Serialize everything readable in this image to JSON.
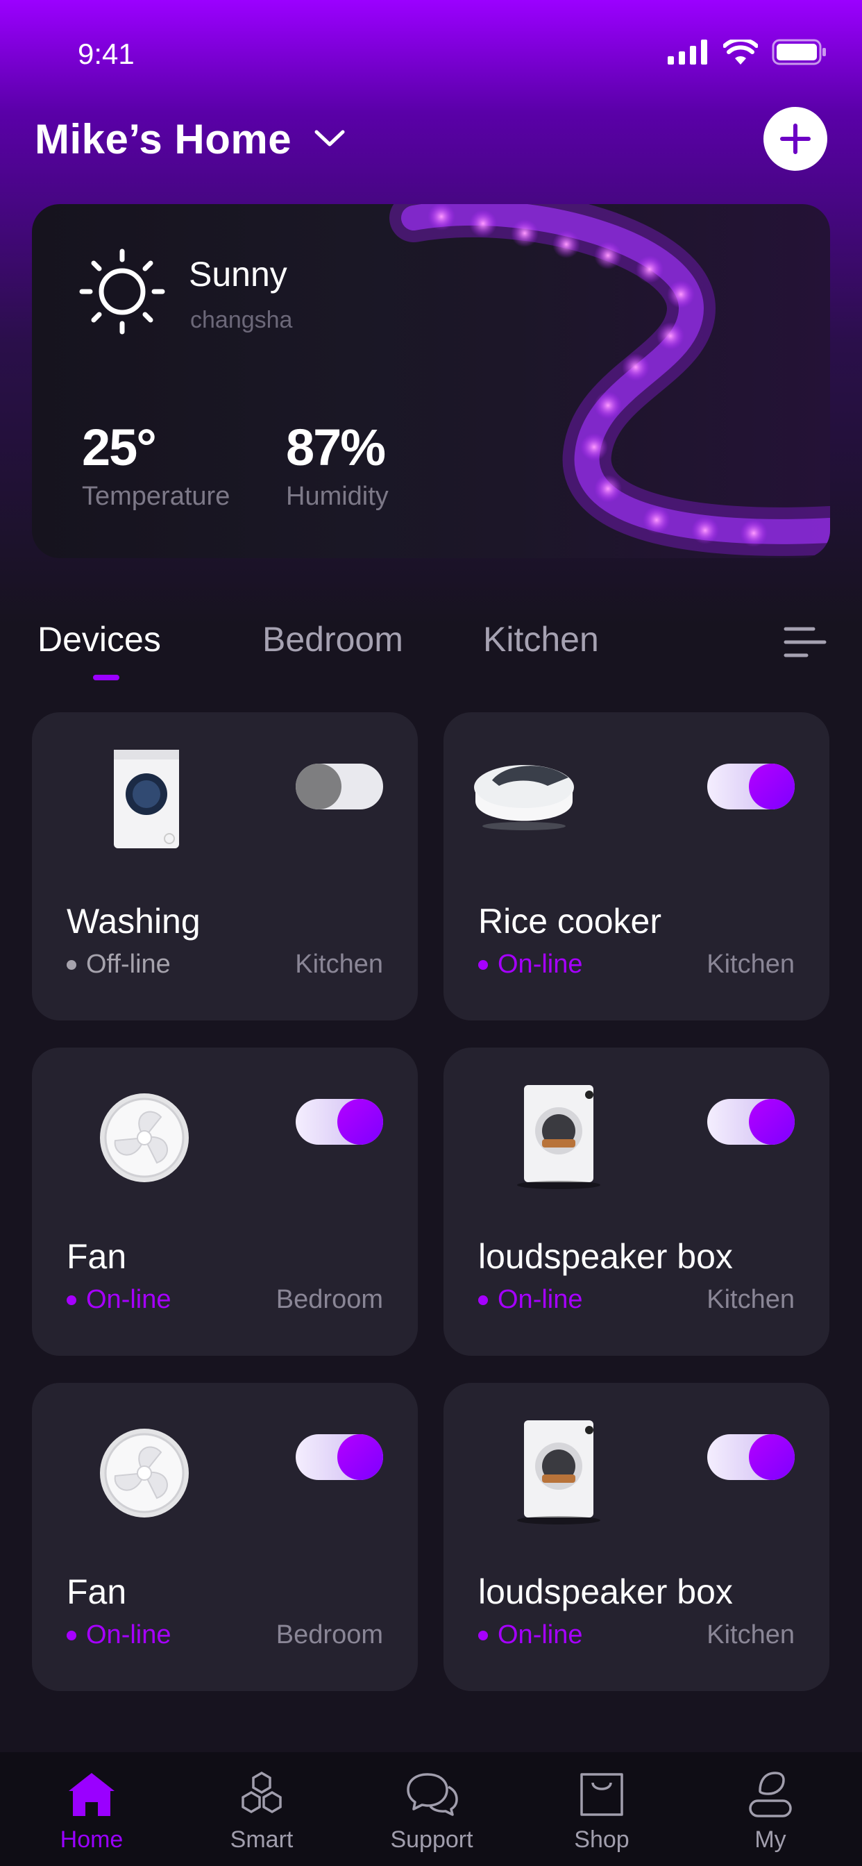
{
  "status_bar": {
    "time": "9:41"
  },
  "header": {
    "home_name": "Mike’s Home"
  },
  "weather": {
    "condition": "Sunny",
    "city": "changsha",
    "temperature_value": "25°",
    "temperature_label": "Temperature",
    "humidity_value": "87%",
    "humidity_label": "Humidity"
  },
  "tabs": [
    {
      "label": "Devices",
      "active": true
    },
    {
      "label": "Bedroom",
      "active": false
    },
    {
      "label": "Kitchen",
      "active": false
    }
  ],
  "devices": [
    {
      "name": "Washing",
      "status": "Off-line",
      "room": "Kitchen",
      "power_on": false,
      "icon": "washing-machine-icon"
    },
    {
      "name": "Rice cooker",
      "status": "On-line",
      "room": "Kitchen",
      "power_on": true,
      "icon": "rice-cooker-icon"
    },
    {
      "name": "Fan",
      "status": "On-line",
      "room": "Bedroom",
      "power_on": true,
      "icon": "fan-icon"
    },
    {
      "name": "loudspeaker box",
      "status": "On-line",
      "room": "Kitchen",
      "power_on": true,
      "icon": "loudspeaker-icon"
    },
    {
      "name": "Fan",
      "status": "On-line",
      "room": "Bedroom",
      "power_on": true,
      "icon": "fan-icon"
    },
    {
      "name": "loudspeaker box",
      "status": "On-line",
      "room": "Kitchen",
      "power_on": true,
      "icon": "loudspeaker-icon"
    }
  ],
  "tabbar": [
    {
      "label": "Home",
      "active": true,
      "icon": "home-icon"
    },
    {
      "label": "Smart",
      "active": false,
      "icon": "hexagon-cluster-icon"
    },
    {
      "label": "Support",
      "active": false,
      "icon": "chat-bubbles-icon"
    },
    {
      "label": "Shop",
      "active": false,
      "icon": "shopping-bag-icon"
    },
    {
      "label": "My",
      "active": false,
      "icon": "user-icon"
    }
  ],
  "colors": {
    "accent": "#9a00ff",
    "card": "#25222f",
    "background": "#17131f"
  }
}
